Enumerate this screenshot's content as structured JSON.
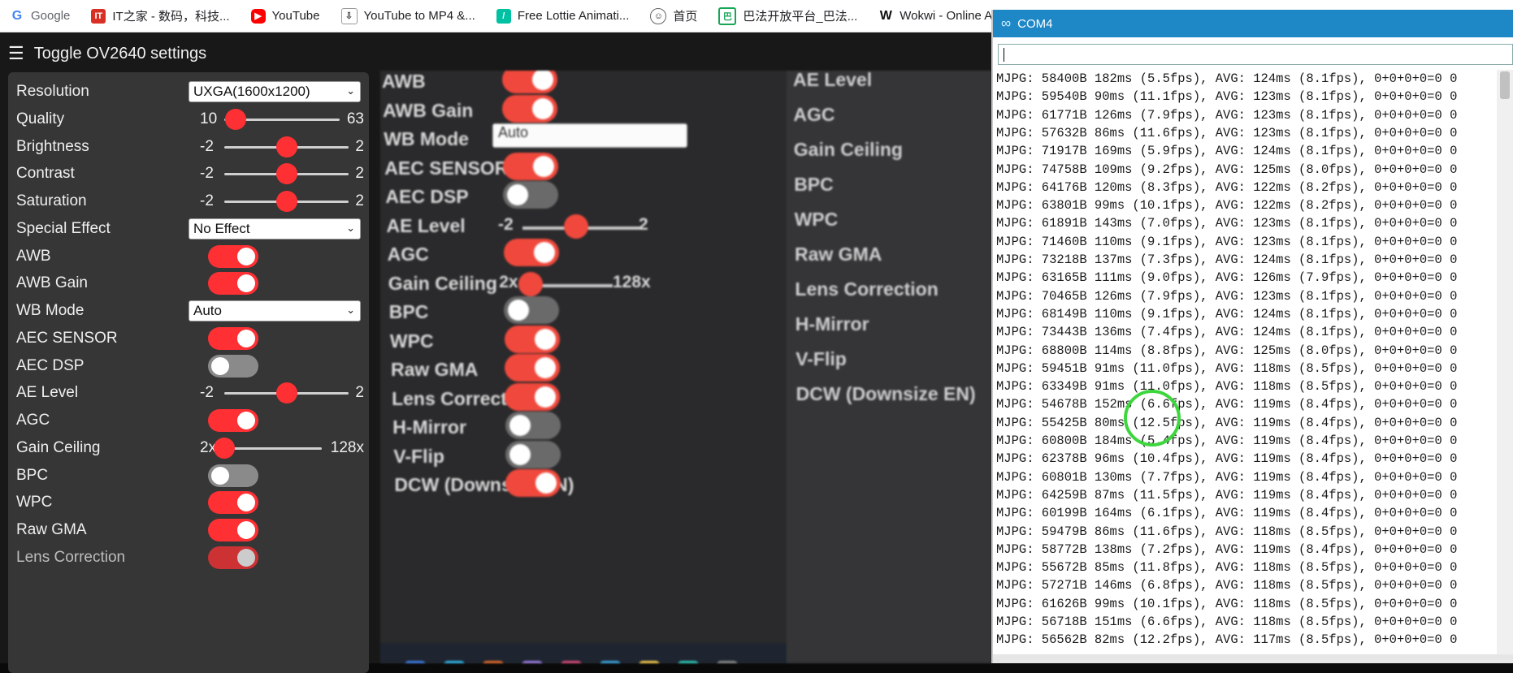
{
  "bookmarks": [
    {
      "name": "bookmark-google",
      "icon": "google-icon",
      "glyph": "G",
      "label": "Google"
    },
    {
      "name": "bookmark-ithome",
      "icon": "ithome-icon",
      "glyph": "IT",
      "label": "IT之家 - 数码，科技..."
    },
    {
      "name": "bookmark-youtube",
      "icon": "youtube-icon",
      "glyph": "▶",
      "label": "YouTube"
    },
    {
      "name": "bookmark-youtube-mp4",
      "icon": "download-icon",
      "glyph": "⇩",
      "label": "YouTube to MP4 &..."
    },
    {
      "name": "bookmark-lottie",
      "icon": "lottie-icon",
      "glyph": "/",
      "label": "Free Lottie Animati..."
    },
    {
      "name": "bookmark-home",
      "icon": "home-icon",
      "glyph": "☺",
      "label": "首页"
    },
    {
      "name": "bookmark-bafa",
      "icon": "bafa-icon",
      "glyph": "巴",
      "label": "巴法开放平台_巴法..."
    },
    {
      "name": "bookmark-wokwi",
      "icon": "wokwi-icon",
      "glyph": "W",
      "label": "Wokwi - Online Ard"
    }
  ],
  "camera": {
    "toggle_label": "Toggle OV2640 settings",
    "settings": [
      {
        "label": "Resolution",
        "type": "select",
        "value": "UXGA(1600x1200)"
      },
      {
        "label": "Quality",
        "type": "range",
        "min": "10",
        "max": "63",
        "value": 0.1
      },
      {
        "label": "Brightness",
        "type": "range",
        "min": "-2",
        "max": "2",
        "value": 0.5
      },
      {
        "label": "Contrast",
        "type": "range",
        "min": "-2",
        "max": "2",
        "value": 0.5
      },
      {
        "label": "Saturation",
        "type": "range",
        "min": "-2",
        "max": "2",
        "value": 0.5
      },
      {
        "label": "Special Effect",
        "type": "select",
        "value": "No Effect"
      },
      {
        "label": "AWB",
        "type": "switch",
        "on": true
      },
      {
        "label": "AWB Gain",
        "type": "switch",
        "on": true
      },
      {
        "label": "WB Mode",
        "type": "select",
        "value": "Auto"
      },
      {
        "label": "AEC SENSOR",
        "type": "switch",
        "on": true
      },
      {
        "label": "AEC DSP",
        "type": "switch",
        "on": false
      },
      {
        "label": "AE Level",
        "type": "range",
        "min": "-2",
        "max": "2",
        "value": 0.5
      },
      {
        "label": "AGC",
        "type": "switch",
        "on": true
      },
      {
        "label": "Gain Ceiling",
        "type": "range",
        "min": "2x",
        "max": "128x",
        "value": 0.0
      },
      {
        "label": "BPC",
        "type": "switch",
        "on": false
      },
      {
        "label": "WPC",
        "type": "switch",
        "on": true
      },
      {
        "label": "Raw GMA",
        "type": "switch",
        "on": true
      },
      {
        "label": "Lens Correction",
        "type": "switch",
        "on": true,
        "dim": true
      }
    ],
    "stream_labels": [
      {
        "text": "AWB",
        "kind": "switch",
        "on": true
      },
      {
        "text": "AWB Gain",
        "kind": "switch",
        "on": true
      },
      {
        "text": "WB Mode",
        "kind": "select",
        "value": "Auto"
      },
      {
        "text": "AEC SENSOR",
        "kind": "switch",
        "on": true
      },
      {
        "text": "AEC DSP",
        "kind": "switch",
        "on": false
      },
      {
        "text": "AE Level",
        "kind": "range",
        "min": "-2",
        "max": "2"
      },
      {
        "text": "AGC",
        "kind": "switch",
        "on": true
      },
      {
        "text": "Gain Ceiling",
        "kind": "range",
        "min": "2x",
        "max": "128x"
      },
      {
        "text": "BPC",
        "kind": "switch",
        "on": false
      },
      {
        "text": "WPC",
        "kind": "switch",
        "on": true
      },
      {
        "text": "Raw GMA",
        "kind": "switch",
        "on": true
      },
      {
        "text": "Lens Correction",
        "kind": "switch",
        "on": true
      },
      {
        "text": "H-Mirror",
        "kind": "switch",
        "on": false
      },
      {
        "text": "V-Flip",
        "kind": "switch",
        "on": false
      },
      {
        "text": "DCW (Downsize EN)",
        "kind": "switch",
        "on": true
      }
    ],
    "stream_right_labels": [
      "AE Level",
      "AGC",
      "Gain Ceiling",
      "BPC",
      "WPC",
      "Raw GMA",
      "Lens Correction",
      "H-Mirror",
      "V-Flip",
      "DCW (Downsize EN)"
    ]
  },
  "serial": {
    "title": "COM4",
    "input_value": "",
    "lines": [
      "MJPG: 58400B 182ms (5.5fps), AVG: 124ms (8.1fps), 0+0+0+0=0 0",
      "MJPG: 59540B 90ms (11.1fps), AVG: 123ms (8.1fps), 0+0+0+0=0 0",
      "MJPG: 61771B 126ms (7.9fps), AVG: 123ms (8.1fps), 0+0+0+0=0 0",
      "MJPG: 57632B 86ms (11.6fps), AVG: 123ms (8.1fps), 0+0+0+0=0 0",
      "MJPG: 71917B 169ms (5.9fps), AVG: 124ms (8.1fps), 0+0+0+0=0 0",
      "MJPG: 74758B 109ms (9.2fps), AVG: 125ms (8.0fps), 0+0+0+0=0 0",
      "MJPG: 64176B 120ms (8.3fps), AVG: 122ms (8.2fps), 0+0+0+0=0 0",
      "MJPG: 63801B 99ms (10.1fps), AVG: 122ms (8.2fps), 0+0+0+0=0 0",
      "MJPG: 61891B 143ms (7.0fps), AVG: 123ms (8.1fps), 0+0+0+0=0 0",
      "MJPG: 71460B 110ms (9.1fps), AVG: 123ms (8.1fps), 0+0+0+0=0 0",
      "MJPG: 73218B 137ms (7.3fps), AVG: 124ms (8.1fps), 0+0+0+0=0 0",
      "MJPG: 63165B 111ms (9.0fps), AVG: 126ms (7.9fps), 0+0+0+0=0 0",
      "MJPG: 70465B 126ms (7.9fps), AVG: 123ms (8.1fps), 0+0+0+0=0 0",
      "MJPG: 68149B 110ms (9.1fps), AVG: 124ms (8.1fps), 0+0+0+0=0 0",
      "MJPG: 73443B 136ms (7.4fps), AVG: 124ms (8.1fps), 0+0+0+0=0 0",
      "MJPG: 68800B 114ms (8.8fps), AVG: 125ms (8.0fps), 0+0+0+0=0 0",
      "MJPG: 59451B 91ms (11.0fps), AVG: 118ms (8.5fps), 0+0+0+0=0 0",
      "MJPG: 63349B 91ms (11.0fps), AVG: 118ms (8.5fps), 0+0+0+0=0 0",
      "MJPG: 54678B 152ms (6.6fps), AVG: 119ms (8.4fps), 0+0+0+0=0 0",
      "MJPG: 55425B 80ms (12.5fps), AVG: 119ms (8.4fps), 0+0+0+0=0 0",
      "MJPG: 60800B 184ms (5.4fps), AVG: 119ms (8.4fps), 0+0+0+0=0 0",
      "MJPG: 62378B 96ms (10.4fps), AVG: 119ms (8.4fps), 0+0+0+0=0 0",
      "MJPG: 60801B 130ms (7.7fps), AVG: 119ms (8.4fps), 0+0+0+0=0 0",
      "MJPG: 64259B 87ms (11.5fps), AVG: 119ms (8.4fps), 0+0+0+0=0 0",
      "MJPG: 60199B 164ms (6.1fps), AVG: 119ms (8.4fps), 0+0+0+0=0 0",
      "MJPG: 59479B 86ms (11.6fps), AVG: 118ms (8.5fps), 0+0+0+0=0 0",
      "MJPG: 58772B 138ms (7.2fps), AVG: 119ms (8.4fps), 0+0+0+0=0 0",
      "MJPG: 55672B 85ms (11.8fps), AVG: 118ms (8.5fps), 0+0+0+0=0 0",
      "MJPG: 57271B 146ms (6.8fps), AVG: 118ms (8.5fps), 0+0+0+0=0 0",
      "MJPG: 61626B 99ms (10.1fps), AVG: 118ms (8.5fps), 0+0+0+0=0 0",
      "MJPG: 56718B 151ms (6.6fps), AVG: 118ms (8.5fps), 0+0+0+0=0 0",
      "MJPG: 56562B 82ms (12.2fps), AVG: 117ms (8.5fps), 0+0+0+0=0 0"
    ]
  },
  "colors": {
    "accent": "#ff3034",
    "panel": "#363636",
    "serial_title": "#1e88c7",
    "cursor_ring": "#3dd63d"
  }
}
